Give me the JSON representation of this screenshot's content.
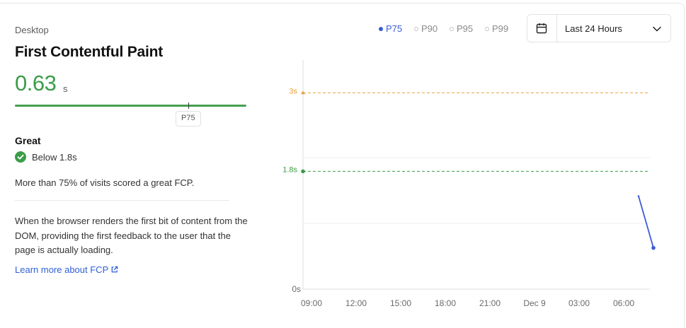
{
  "card": {
    "device": "Desktop",
    "title": "First Contentful Paint",
    "value": "0.63",
    "unit": "s",
    "percentile_marker": "P75",
    "rating": "Great",
    "threshold": "Below 1.8s",
    "summary": "More than 75% of visits scored a great FCP.",
    "description": "When the browser renders the first bit of content from the DOM, providing the first feedback to the user that the page is actually loading.",
    "learn_more": "Learn more about FCP"
  },
  "legend": [
    {
      "label": "P75",
      "active": true
    },
    {
      "label": "P90",
      "active": false
    },
    {
      "label": "P95",
      "active": false
    },
    {
      "label": "P99",
      "active": false
    }
  ],
  "range_picker": {
    "selected": "Last 24 Hours",
    "icon": "calendar-icon"
  },
  "colors": {
    "good": "#3b9d48",
    "needs_improvement": "#e8a13a",
    "series": "#3c5bd8",
    "link": "#3060d8"
  },
  "chart_data": {
    "type": "line",
    "x_labels": [
      "09:00",
      "12:00",
      "15:00",
      "18:00",
      "21:00",
      "Dec 9",
      "03:00",
      "06:00"
    ],
    "ylim": [
      0,
      3.5
    ],
    "y_tick_labels": [
      "0s"
    ],
    "thresholds": [
      {
        "label": "3s",
        "value": 3.0,
        "color": "#e8a13a",
        "marker": "triangle"
      },
      {
        "label": "1.8s",
        "value": 1.8,
        "color": "#3b9d48",
        "marker": "circle"
      }
    ],
    "series": [
      {
        "name": "P75",
        "color": "#3c5bd8",
        "points": [
          {
            "x": "07:00",
            "y": 1.42
          },
          {
            "x": "08:00",
            "y": 0.63
          }
        ]
      }
    ],
    "grid": true
  }
}
